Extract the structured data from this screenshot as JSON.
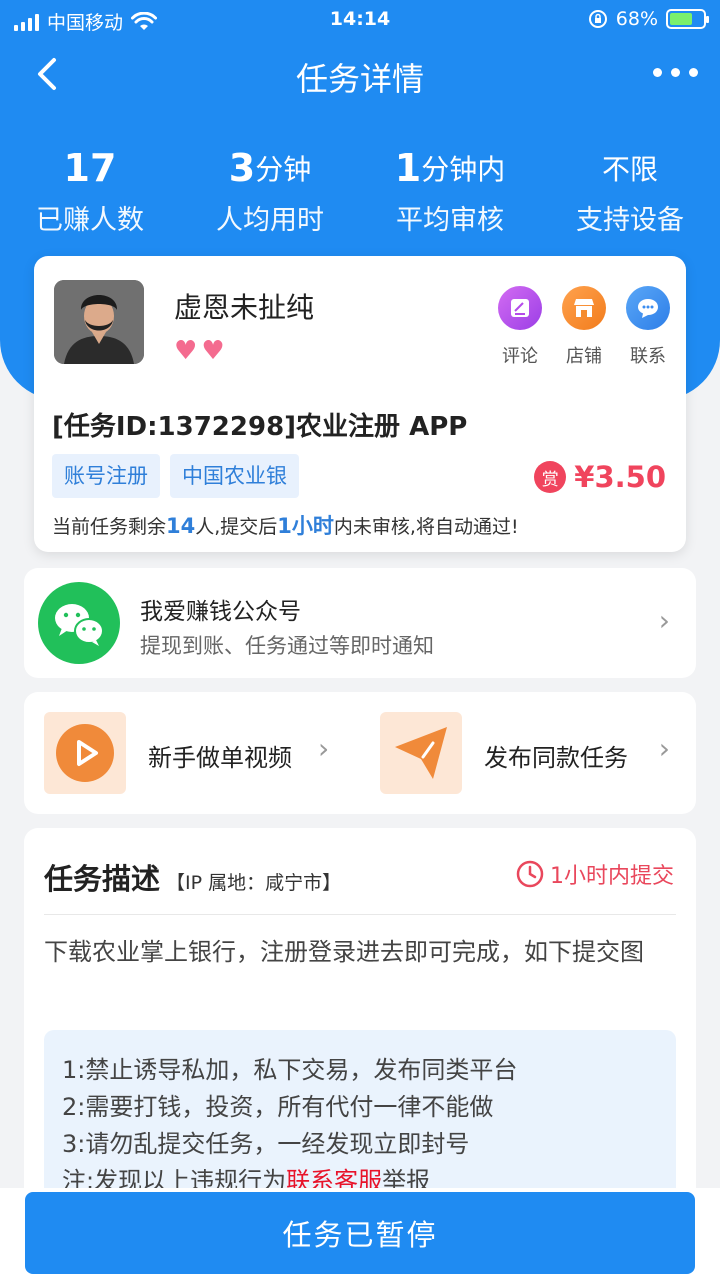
{
  "status_bar": {
    "carrier": "中国移动",
    "time": "14:14",
    "battery": "68%"
  },
  "nav": {
    "title": "任务详情"
  },
  "stats": [
    {
      "num": "17",
      "unit": "",
      "label": "已赚人数"
    },
    {
      "num": "3",
      "unit": "分钟",
      "label": "人均用时"
    },
    {
      "num": "1",
      "unit": "分钟内",
      "label": "平均审核"
    },
    {
      "num": "",
      "unit": "不限",
      "label": "支持设备"
    }
  ],
  "task": {
    "publisher": "虚恩未扯纯",
    "actions": {
      "comment": "评论",
      "shop": "店铺",
      "contact": "联系"
    },
    "title": "[任务ID:1372298]农业注册 APP",
    "tags": [
      "账号注册",
      "中国农业银"
    ],
    "reward_badge": "赏",
    "reward": "¥3.50",
    "remain_prefix": "当前任务剩余",
    "remain_count": "14",
    "remain_mid": "人,提交后",
    "remain_time": "1小时",
    "remain_suffix": "内未审核,将自动通过!"
  },
  "wechat": {
    "title": "我爱赚钱公众号",
    "subtitle": "提现到账、任务通过等即时通知"
  },
  "links": {
    "video": "新手做单视频",
    "publish": "发布同款任务"
  },
  "description": {
    "title": "任务描述",
    "ip": "【IP 属地：咸宁市】",
    "deadline": "1小时内提交",
    "text": "下载农业掌上银行，注册登录进去即可完成，如下提交图",
    "rules": [
      "1:禁止诱导私加，私下交易，发布同类平台",
      "2:需要打钱，投资，所有代付一律不能做",
      "3:请勿乱提交任务，一经发现立即封号"
    ],
    "rule4_prefix": "注:发现以上违规行为",
    "rule4_link": "联系客服",
    "rule4_suffix": "举报"
  },
  "bottom": {
    "button": "任务已暂停"
  },
  "colors": {
    "primary": "#1f8bf2",
    "reward": "#f0445d",
    "wechat": "#21c05a"
  }
}
